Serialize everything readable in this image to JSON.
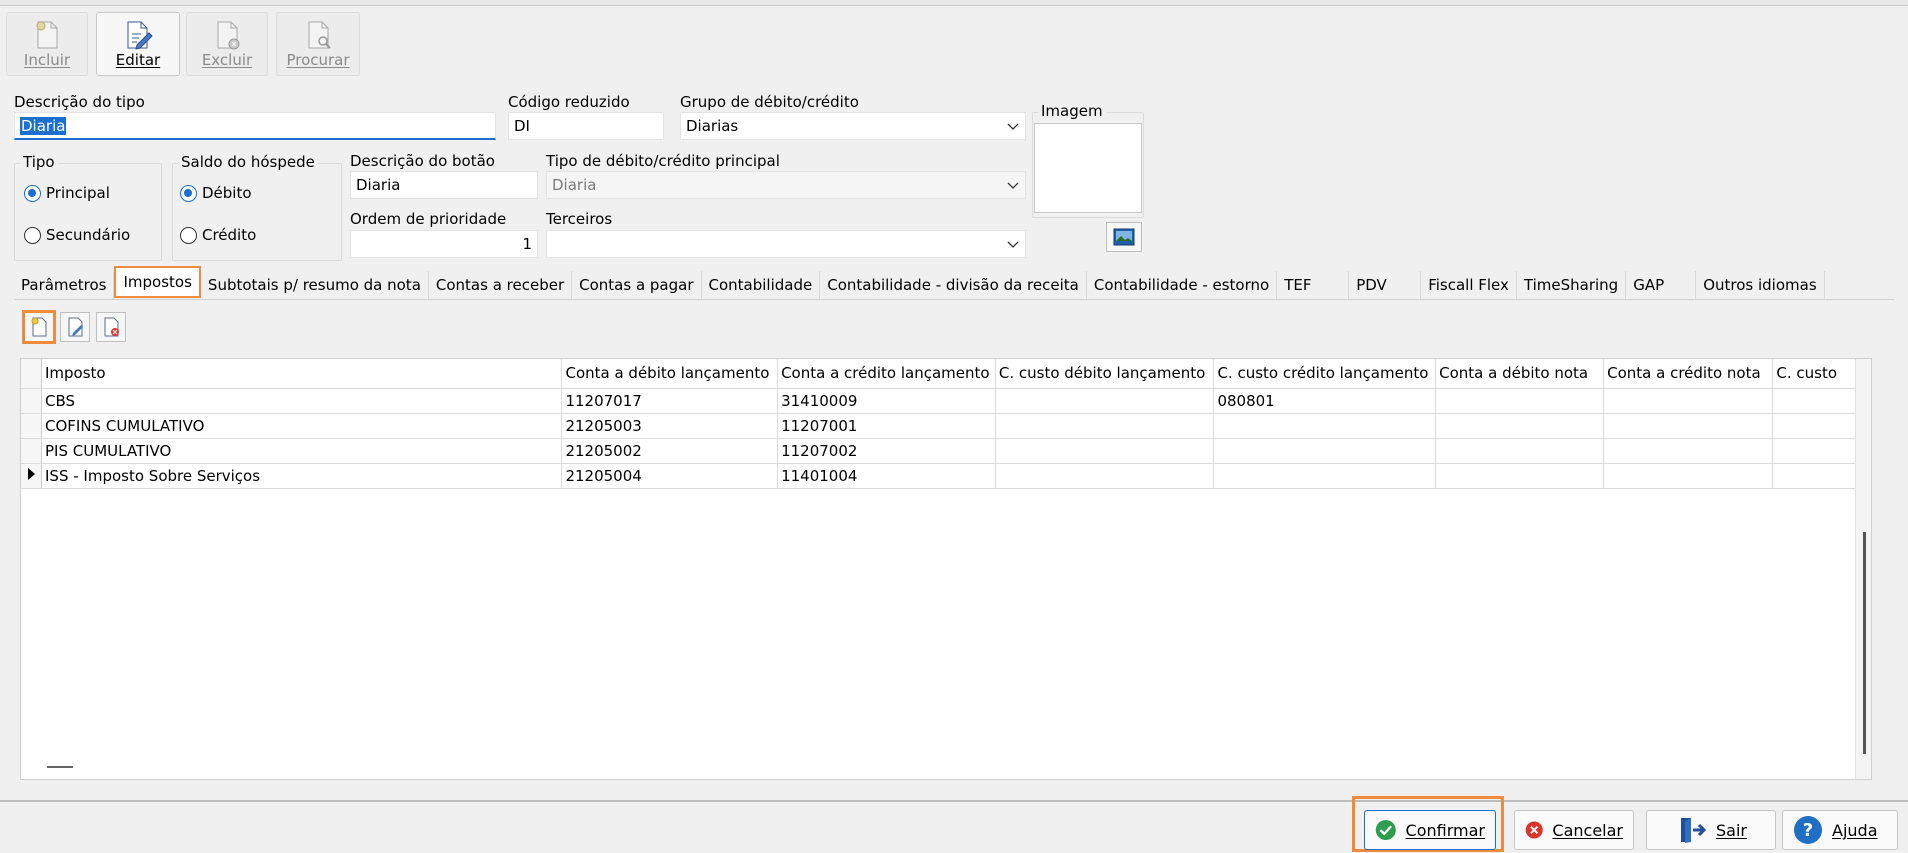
{
  "toolbar": {
    "incluir": "Incluir",
    "editar": "Editar",
    "excluir": "Excluir",
    "procurar": "Procurar"
  },
  "form": {
    "descricao_tipo_label": "Descrição do tipo",
    "descricao_tipo_value": "Diaria",
    "codigo_reduzido_label": "Código reduzido",
    "codigo_reduzido_value": "DI",
    "grupo_label": "Grupo de débito/crédito",
    "grupo_value": "Diarias",
    "imagem_label": "Imagem",
    "tipo_label": "Tipo",
    "tipo_principal": "Principal",
    "tipo_secundario": "Secundário",
    "saldo_label": "Saldo do hóspede",
    "saldo_debito": "Débito",
    "saldo_credito": "Crédito",
    "desc_botao_label": "Descrição do botão",
    "desc_botao_value": "Diaria",
    "tipo_principal_dc_label": "Tipo de débito/crédito principal",
    "tipo_principal_dc_value": "Diaria",
    "ordem_label": "Ordem de prioridade",
    "ordem_value": "1",
    "terceiros_label": "Terceiros",
    "terceiros_value": ""
  },
  "tabs": [
    "Parâmetros",
    "Impostos",
    "Subtotais p/ resumo da nota",
    "Contas a receber",
    "Contas a pagar",
    "Contabilidade",
    "Contabilidade - divisão da receita",
    "Contabilidade - estorno",
    "TEF",
    "PDV",
    "Fiscall Flex",
    "TimeSharing",
    "GAP",
    "Outros idiomas"
  ],
  "grid": {
    "columns": [
      "Imposto",
      "Conta a débito lançamento",
      "Conta a crédito lançamento",
      "C. custo débito lançamento",
      "C. custo crédito lançamento",
      "Conta a débito nota",
      "Conta a crédito nota",
      "C. custo"
    ],
    "rows": [
      [
        "CBS",
        "11207017",
        "31410009",
        "",
        "080801",
        "",
        "",
        ""
      ],
      [
        "COFINS CUMULATIVO",
        "21205003",
        "11207001",
        "",
        "",
        "",
        "",
        ""
      ],
      [
        "PIS CUMULATIVO",
        "21205002",
        "11207002",
        "",
        "",
        "",
        "",
        ""
      ],
      [
        "ISS - Imposto Sobre Serviços",
        "21205004",
        "11401004",
        "",
        "",
        "",
        "",
        ""
      ]
    ]
  },
  "footer": {
    "confirmar": "Confirmar",
    "cancelar": "Cancelar",
    "sair": "Sair",
    "ajuda": "Ajuda"
  },
  "colors": {
    "highlight": "#f08a3c",
    "accent": "#1a6fd1",
    "confirm_green": "#2e9d4f",
    "cancel_red": "#d9342b",
    "help_blue": "#1f6fc5"
  }
}
